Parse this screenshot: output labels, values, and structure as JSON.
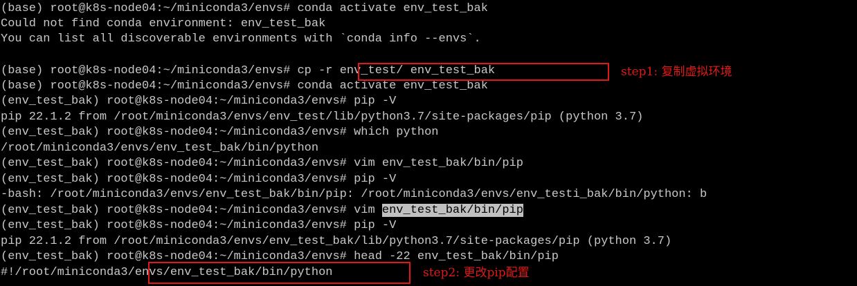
{
  "terminal": {
    "lines": [
      {
        "text": "(base) root@k8s-node04:~/miniconda3/envs# conda activate env_test_bak"
      },
      {
        "text": "Could not find conda environment: env_test_bak"
      },
      {
        "text": "You can list all discoverable environments with `conda info --envs`."
      },
      {
        "text": ""
      },
      {
        "prompt": "(base) root@k8s-node04:~/miniconda3/envs# ",
        "command": "cp -r env_test/ env_test_bak"
      },
      {
        "text": "(base) root@k8s-node04:~/miniconda3/envs# conda activate env_test_bak"
      },
      {
        "text": "(env_test_bak) root@k8s-node04:~/miniconda3/envs# pip -V"
      },
      {
        "text": "pip 22.1.2 from /root/miniconda3/envs/env_test/lib/python3.7/site-packages/pip (python 3.7)"
      },
      {
        "text": "(env_test_bak) root@k8s-node04:~/miniconda3/envs# which python"
      },
      {
        "text": "/root/miniconda3/envs/env_test_bak/bin/python"
      },
      {
        "text": "(env_test_bak) root@k8s-node04:~/miniconda3/envs# vim env_test_bak/bin/pip"
      },
      {
        "text": "(env_test_bak) root@k8s-node04:~/miniconda3/envs# pip -V"
      },
      {
        "text": "-bash: /root/miniconda3/envs/env_test_bak/bin/pip: /root/miniconda3/envs/env_testi_bak/bin/python: b"
      },
      {
        "prompt": "(env_test_bak) root@k8s-node04:~/miniconda3/envs# vim ",
        "selected": "env_test_bak/bin/pip"
      },
      {
        "text": "(env_test_bak) root@k8s-node04:~/miniconda3/envs# pip -V"
      },
      {
        "text": "pip 22.1.2 from /root/miniconda3/envs/env_test_bak/lib/python3.7/site-packages/pip (python 3.7)"
      },
      {
        "text": "(env_test_bak) root@k8s-node04:~/miniconda3/envs# head -22 env_test_bak/bin/pip"
      },
      {
        "text": "#!/root/miniconda3/envs/env_test_bak/bin/python"
      }
    ]
  },
  "annotations": {
    "step1": {
      "label": "step1: 复制虚拟环境"
    },
    "step2": {
      "label": "step2: 更改pip配置"
    },
    "color": "#e01818"
  }
}
